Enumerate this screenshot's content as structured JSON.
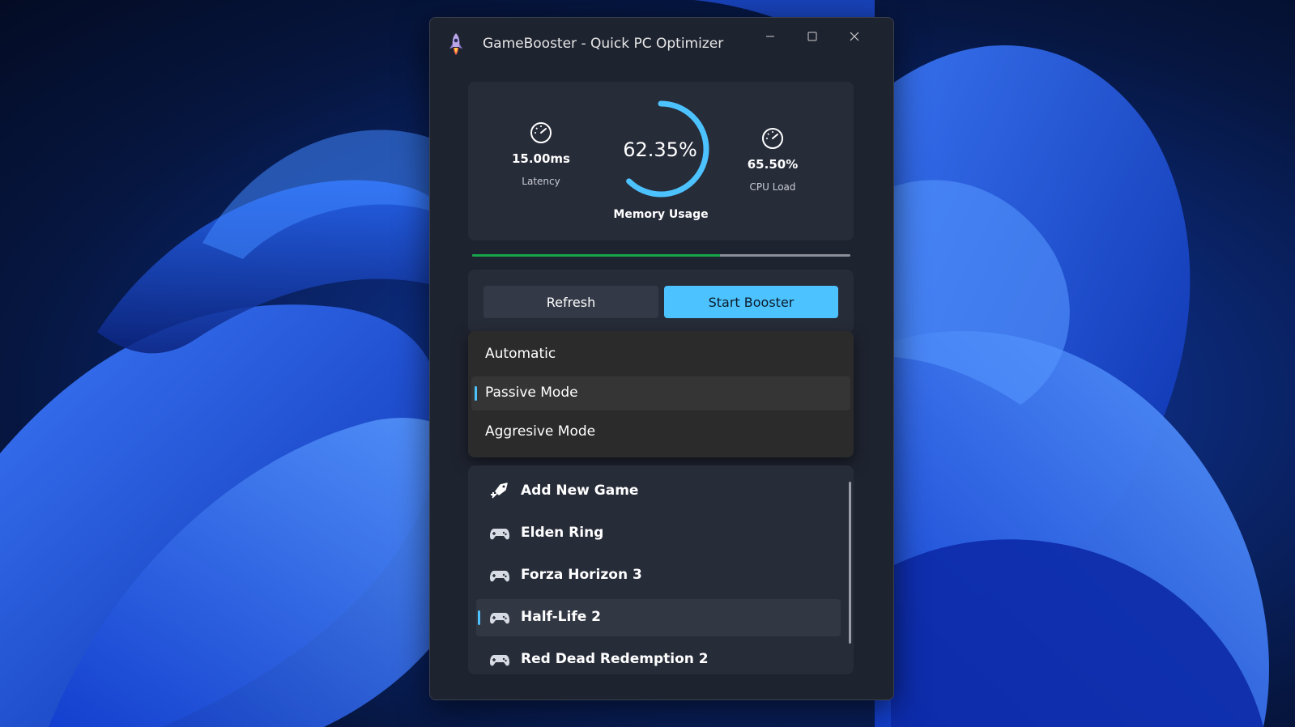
{
  "window": {
    "title": "GameBooster - Quick PC Optimizer",
    "app_icon": "rocket-icon",
    "controls": [
      "minimize-icon",
      "maximize-icon",
      "close-icon"
    ]
  },
  "stats": {
    "latency": {
      "value": "15.00ms",
      "label": "Latency",
      "icon": "speedometer-icon"
    },
    "memory": {
      "value": "62.35%",
      "label": "Memory Usage",
      "fraction": 0.6235
    },
    "cpu": {
      "value": "65.50%",
      "label": "CPU Load",
      "icon": "speedometer-icon"
    }
  },
  "progress": {
    "fraction": 0.655,
    "color": "#17a54a"
  },
  "actions": {
    "refresh_label": "Refresh",
    "start_label": "Start Booster"
  },
  "modes": {
    "selected_index": 1,
    "items": [
      {
        "label": "Automatic"
      },
      {
        "label": "Passive Mode"
      },
      {
        "label": "Aggresive Mode"
      }
    ]
  },
  "games": {
    "selected_index": 3,
    "items": [
      {
        "label": "Add New Game",
        "icon": "add-game-icon"
      },
      {
        "label": "Elden Ring",
        "icon": "gamepad-icon"
      },
      {
        "label": "Forza Horizon 3",
        "icon": "gamepad-icon"
      },
      {
        "label": "Half-Life 2",
        "icon": "gamepad-icon"
      },
      {
        "label": "Red Dead Redemption 2",
        "icon": "gamepad-icon"
      }
    ]
  },
  "colors": {
    "accent": "#4cc2ff",
    "window_bg": "#1e2330",
    "card_bg": "#272c39"
  }
}
